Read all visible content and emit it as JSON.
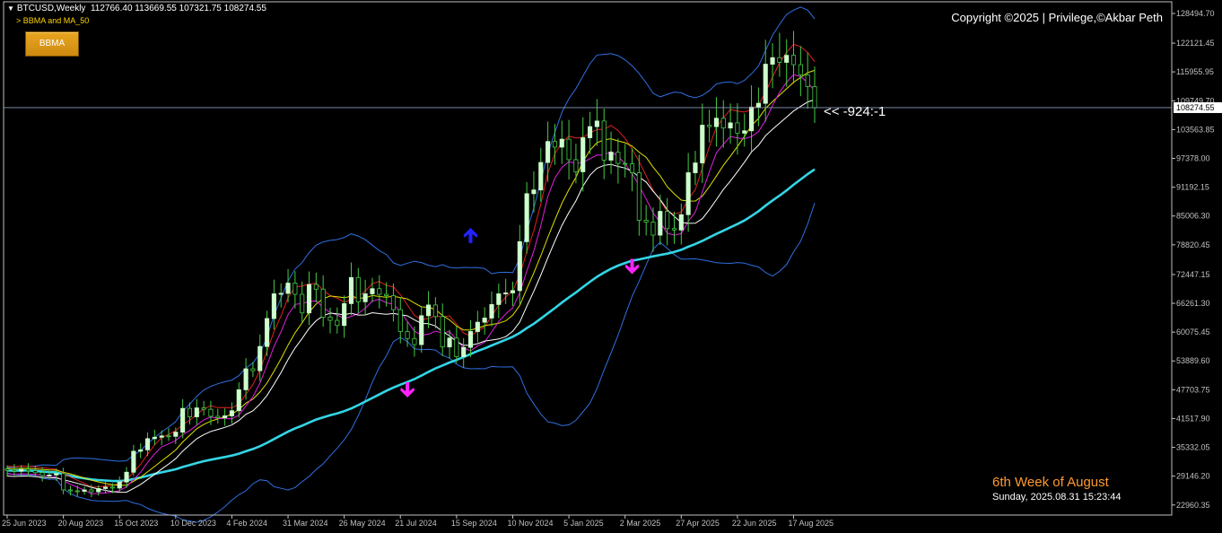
{
  "header": {
    "symbol": "BTCUSD,Weekly",
    "ohlc": "112766.40 113669.55 107321.75 108274.55",
    "indicator_label": "> BBMA and MA_50"
  },
  "toolbar": {
    "bbma_button": "BBMA"
  },
  "copyright": "Copyright ©2025 | Privilege,©Akbar Peth",
  "annotation": "<< -924:-1",
  "week_label": "6th Week of August",
  "datetime": "Sunday, 2025.08.31 15:23:44",
  "colors": {
    "background": "#000000",
    "bull_candle": "#ccffcc",
    "bear_candle": "#000000",
    "wick": "#44cc44",
    "bollinger": "#2f6fe0",
    "ma50": "#33d6e6",
    "ma_red": "#e02020",
    "ma_yellow": "#e0e000",
    "ma_magenta": "#e020e0",
    "ma_white": "#ffffff",
    "arrow_up": "#2222ff",
    "arrow_down": "#ff22ff",
    "axis": "#c0c0c0"
  },
  "chart_data": {
    "type": "candlestick",
    "title": "BTCUSD,Weekly",
    "ylim": [
      20800,
      131000
    ],
    "grid": false,
    "current_price": 108274.55,
    "price_line": 108274.55,
    "y_ticks": [
      "128494.70",
      "122121.45",
      "115955.95",
      "109749.70",
      "103563.85",
      "97378.00",
      "91192.15",
      "85006.30",
      "78820.45",
      "72447.15",
      "66261.30",
      "60075.45",
      "53889.60",
      "47703.75",
      "41517.90",
      "35332.05",
      "29146.20",
      "22960.35"
    ],
    "x_ticks": [
      {
        "label": "25 Jun 2023",
        "index": 0
      },
      {
        "label": "20 Aug 2023",
        "index": 8
      },
      {
        "label": "15 Oct 2023",
        "index": 16
      },
      {
        "label": "10 Dec 2023",
        "index": 24
      },
      {
        "label": "4 Feb 2024",
        "index": 32
      },
      {
        "label": "31 Mar 2024",
        "index": 40
      },
      {
        "label": "26 May 2024",
        "index": 48
      },
      {
        "label": "21 Jul 2024",
        "index": 56
      },
      {
        "label": "15 Sep 2024",
        "index": 64
      },
      {
        "label": "10 Nov 2024",
        "index": 72
      },
      {
        "label": "5 Jan 2025",
        "index": 80
      },
      {
        "label": "2 Mar 2025",
        "index": 88
      },
      {
        "label": "27 Apr 2025",
        "index": 96
      },
      {
        "label": "22 Jun 2025",
        "index": 104
      },
      {
        "label": "17 Aug 2025",
        "index": 112
      }
    ],
    "closes": [
      30400,
      30200,
      30600,
      30300,
      29900,
      29300,
      29400,
      29700,
      26200,
      26000,
      25900,
      26200,
      25800,
      26500,
      26800,
      26600,
      27900,
      30000,
      34500,
      34800,
      37200,
      37500,
      37800,
      37700,
      38600,
      43700,
      41900,
      43800,
      43500,
      42000,
      41700,
      42100,
      43200,
      47700,
      52200,
      51800,
      57000,
      63000,
      68300,
      68400,
      70600,
      68200,
      64200,
      70300,
      69300,
      63300,
      62600,
      61500,
      66200,
      71800,
      66600,
      68300,
      69400,
      68200,
      67900,
      64900,
      60200,
      58700,
      57400,
      63600,
      65900,
      63400,
      56900,
      58800,
      54800,
      56800,
      60200,
      62200,
      63100,
      66000,
      68300,
      68500,
      69000,
      79500,
      89800,
      90600,
      96500,
      101000,
      99800,
      101500,
      97100,
      94500,
      101800,
      104200,
      105400,
      97000,
      98700,
      96300,
      96200,
      94300,
      84100,
      83700,
      80900,
      86000,
      82300,
      82000,
      85300,
      94300,
      96400,
      104500,
      104200,
      106000,
      103900,
      105000,
      102800,
      103300,
      108400,
      109200,
      117600,
      119000,
      118000,
      119500,
      117500,
      115300,
      112800,
      108274
    ]
  }
}
